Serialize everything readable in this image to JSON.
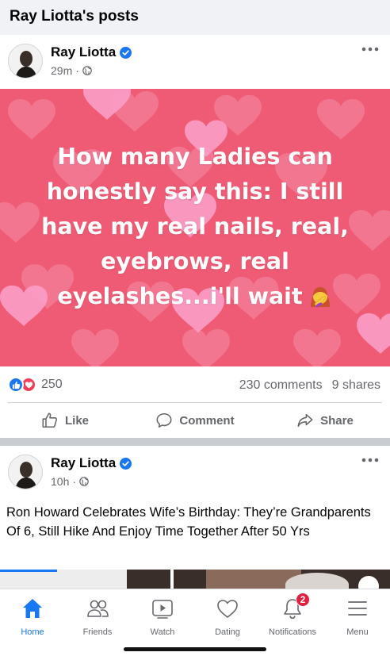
{
  "page": {
    "title": "Ray Liotta's posts"
  },
  "colors": {
    "accent": "#1877f2",
    "image_bg": "#ef5b74",
    "badge": "#e41e3f",
    "secondary_text": "#65676b"
  },
  "posts": [
    {
      "author": "Ray Liotta",
      "verified": true,
      "time": "29m",
      "audience_icon": "globe-icon",
      "image_text_lines": [
        "How many Ladies can",
        "honestly say this: I still",
        "have my real nails, real,",
        "eyebrows, real",
        "eyelashes...i'll wait"
      ],
      "image_emoji": "woman-facepalming",
      "reaction_count": "250",
      "comments": "230 comments",
      "shares": "9 shares",
      "actions": {
        "like": "Like",
        "comment": "Comment",
        "share": "Share"
      }
    },
    {
      "author": "Ray Liotta",
      "verified": true,
      "time": "10h",
      "audience_icon": "globe-icon",
      "text": "Ron Howard Celebrates Wife’s Birthday: They’re Grandparents Of 6, Still Hike And Enjoy Time Together After 50 Yrs"
    }
  ],
  "tabbar": {
    "items": [
      {
        "label": "Home",
        "icon": "home-icon",
        "active": true
      },
      {
        "label": "Friends",
        "icon": "friends-icon"
      },
      {
        "label": "Watch",
        "icon": "watch-icon"
      },
      {
        "label": "Dating",
        "icon": "dating-icon"
      },
      {
        "label": "Notifications",
        "icon": "bell-icon",
        "badge": "2"
      },
      {
        "label": "Menu",
        "icon": "menu-icon"
      }
    ]
  }
}
